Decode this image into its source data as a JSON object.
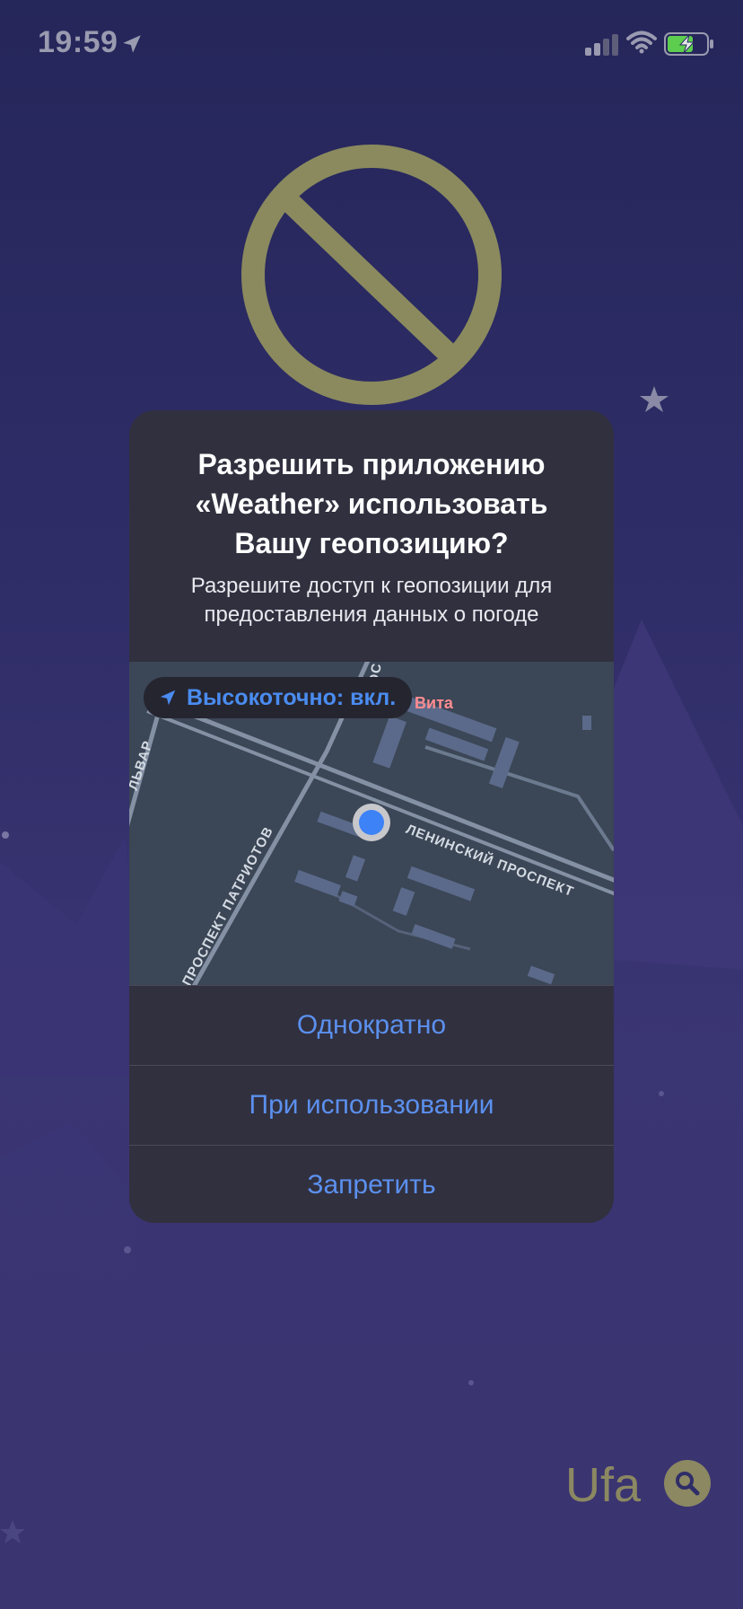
{
  "status_bar": {
    "time": "19:59",
    "icons": [
      "location-arrow-icon",
      "cellular-signal-icon",
      "wifi-icon",
      "battery-charging-icon"
    ]
  },
  "background": {
    "icon": "no-entry-icon",
    "colors": {
      "sky": "#2b2b64",
      "stop_sign": "#8a8a5e",
      "mountains": "#3f3776"
    }
  },
  "alert": {
    "title": "Разрешить приложению «Weather» использовать Вашу геопозицию?",
    "message": "Разрешите доступ к геопозиции для предоставления данных о погоде",
    "precise": {
      "label": "Высокоточно: вкл.",
      "icon": "location-arrow-icon"
    },
    "map": {
      "poi": "Вита",
      "streets": [
        "ЛЕНИНСКИЙ ПРОСПЕКТ",
        "ПРОСПЕКТ ПАТРИОТОВ",
        "ЛЬВАР",
        "ОС"
      ]
    },
    "buttons": [
      {
        "label": "Однократно"
      },
      {
        "label": "При использовании"
      },
      {
        "label": "Запретить"
      }
    ],
    "colors": {
      "button_text": "#5b90ee",
      "panel": "#31303f"
    }
  },
  "footer": {
    "city": "Ufa",
    "search_icon": "search-icon"
  }
}
